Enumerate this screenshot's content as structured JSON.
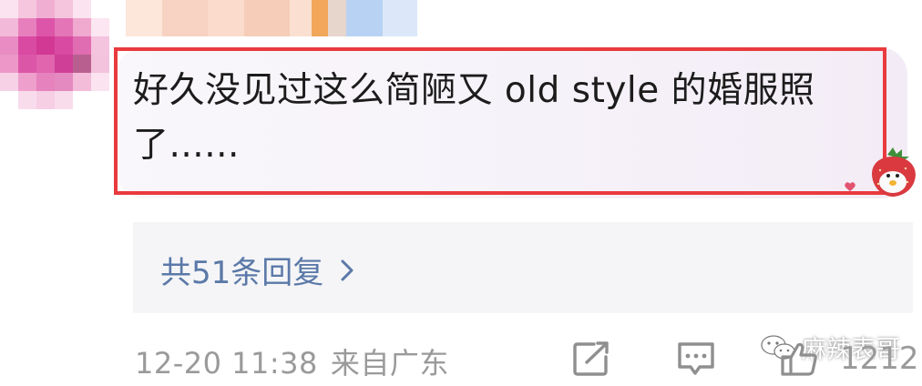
{
  "comment": {
    "text": "好久没见过这么简陋又 old style 的婚服照了......"
  },
  "replies": {
    "label": "共51条回复"
  },
  "meta": {
    "time": "12-20 11:38",
    "location": "来自广东"
  },
  "actions": {
    "like_count": "1212",
    "share_icon": "share-icon",
    "reply_icon": "comment-icon",
    "like_icon": "thumbs-up-icon"
  },
  "watermark": {
    "text": "麻辣表哥"
  },
  "colors": {
    "highlight_border": "#e93a3e",
    "reply_link": "#5b79a8",
    "meta_text": "#9a9a9a",
    "bubble_bg": "#f6f2f9",
    "replies_bg": "#f5f5f7"
  }
}
